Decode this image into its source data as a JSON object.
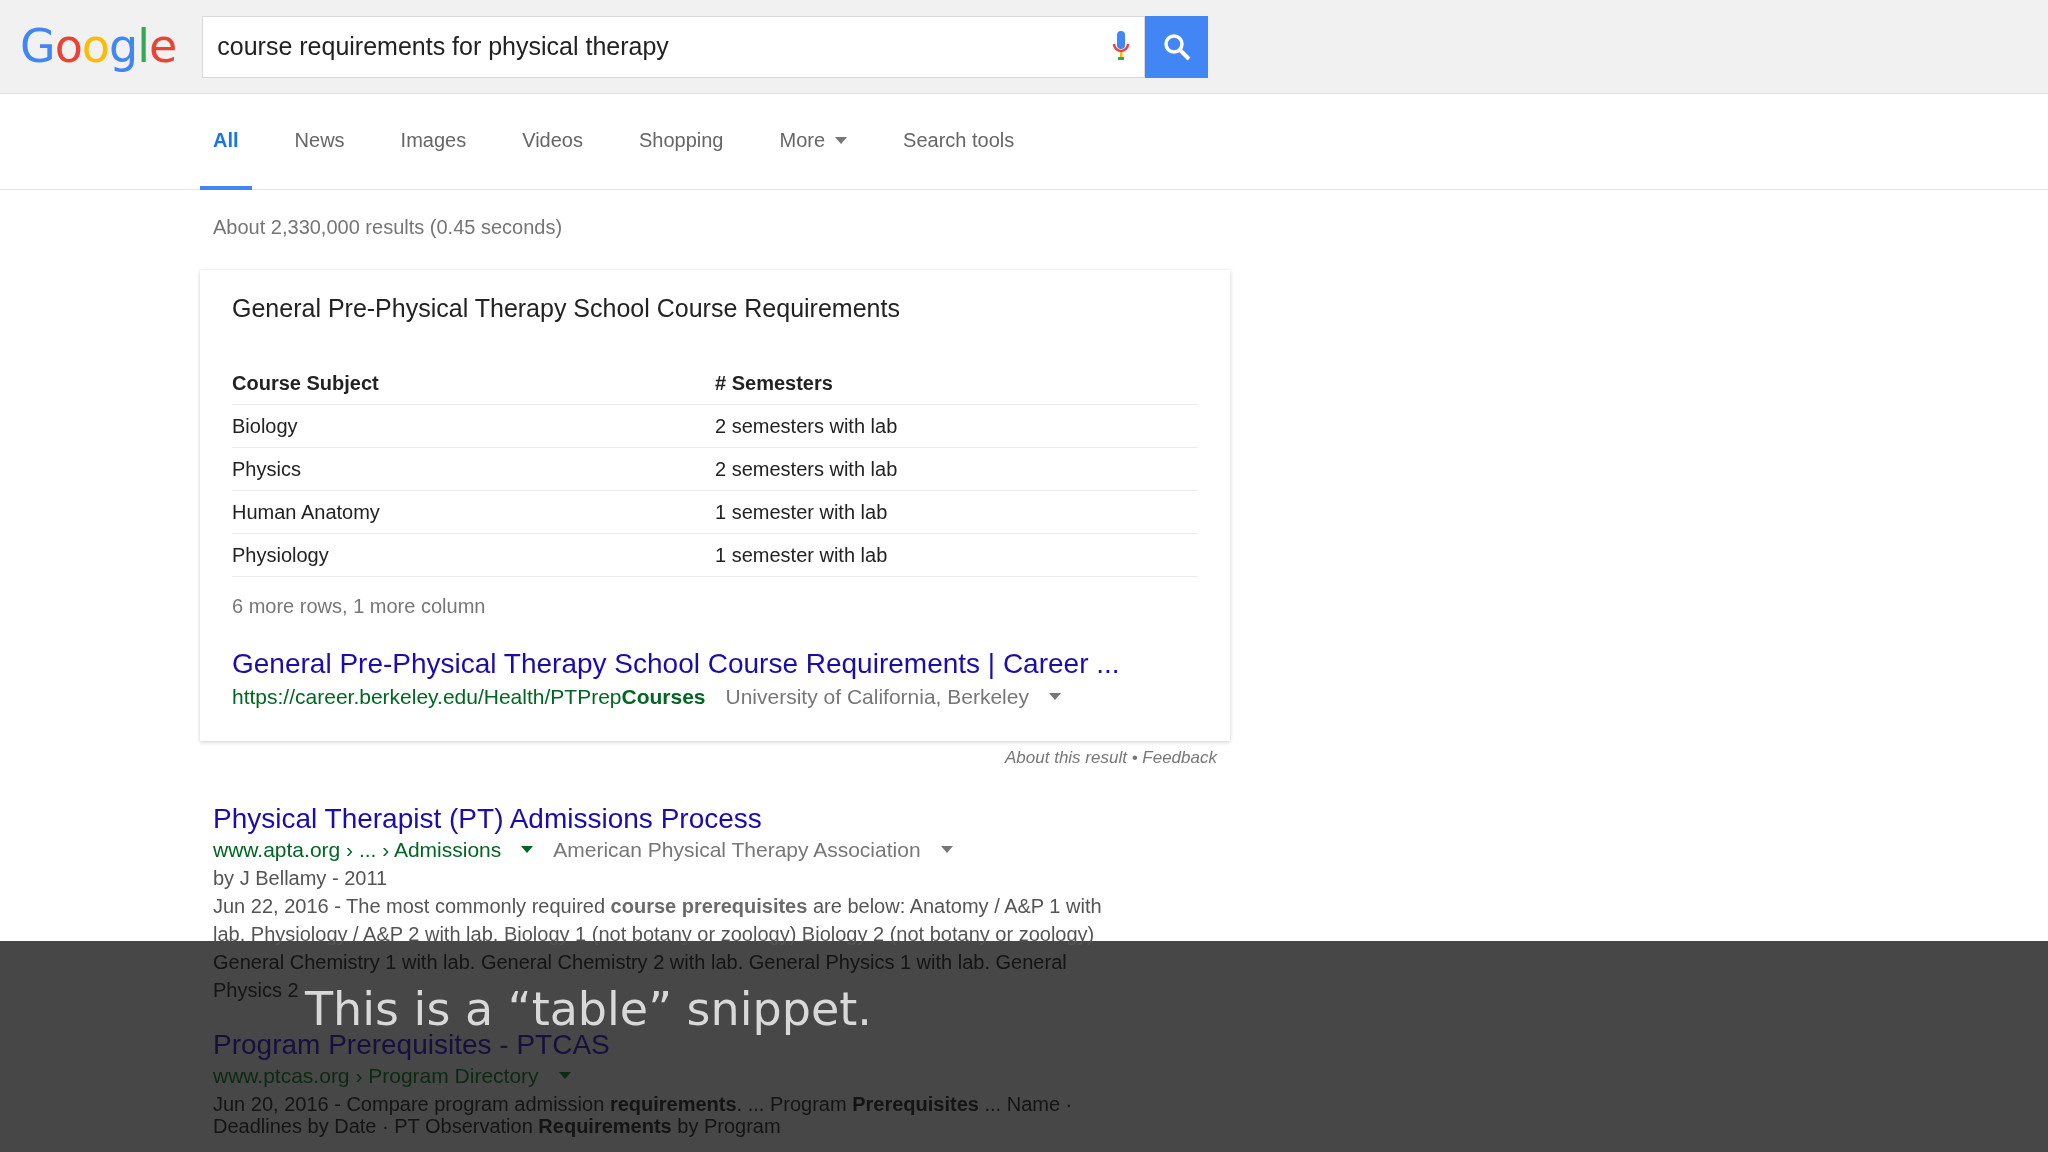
{
  "logo": "Google",
  "search": {
    "query": "course requirements for physical therapy"
  },
  "tabs": [
    {
      "label": "All",
      "selected": true,
      "kind": "tab"
    },
    {
      "label": "News",
      "selected": false,
      "kind": "tab"
    },
    {
      "label": "Images",
      "selected": false,
      "kind": "tab"
    },
    {
      "label": "Videos",
      "selected": false,
      "kind": "tab"
    },
    {
      "label": "Shopping",
      "selected": false,
      "kind": "tab"
    },
    {
      "label": "More",
      "selected": false,
      "kind": "menu"
    },
    {
      "label": "Search tools",
      "selected": false,
      "kind": "tab"
    }
  ],
  "result_stats": "About 2,330,000 results (0.45 seconds)",
  "featured_snippet": {
    "title": "General Pre-Physical Therapy School Course Requirements",
    "table": {
      "columns": [
        "Course Subject",
        "# Semesters"
      ],
      "rows": [
        [
          "Biology",
          "2 semesters with lab"
        ],
        [
          "Physics",
          "2 semesters with lab"
        ],
        [
          "Human Anatomy",
          "1 semester with lab"
        ],
        [
          "Physiology",
          "1 semester with lab"
        ]
      ]
    },
    "more": "6 more rows, 1 more column",
    "link_title": "General Pre-Physical Therapy School Course Requirements | Career ...",
    "url": "https://career.berkeley.edu/Health/PTPrep**Courses**",
    "source": "University of California, Berkeley"
  },
  "feedback": {
    "links": [
      "About this result",
      "Feedback"
    ],
    "separator": "•"
  },
  "results": [
    {
      "title": "Physical Therapist (PT) Admissions Process",
      "breadcrumb": "www.apta.org › ... › Admissions",
      "source": "American Physical Therapy Association",
      "byline": "by J Bellamy - 2011",
      "snippet_lines": [
        "Jun 22, 2016 - The most commonly required **course prerequisites** are below: Anatomy / A&P 1 with",
        "lab. Physiology / A&P 2 with lab. Biology 1 (not botany or zoology) Biology 2 (not botany or zoology)",
        "General Chemistry 1 with lab. General Chemistry 2 with lab. General Physics 1 with lab. General",
        "Physics 2"
      ]
    },
    {
      "title": "Program Prerequisites - PTCAS",
      "breadcrumb": "www.ptcas.org › Program Directory",
      "snippet_lines": [
        "Jun 20, 2016 - Compare program admission **requirements**. ... Program **Prerequisites** ... Name ·",
        "Deadlines by Date · PT Observation **Requirements** by Program"
      ]
    }
  ],
  "caption": "This is a “table” snippet."
}
